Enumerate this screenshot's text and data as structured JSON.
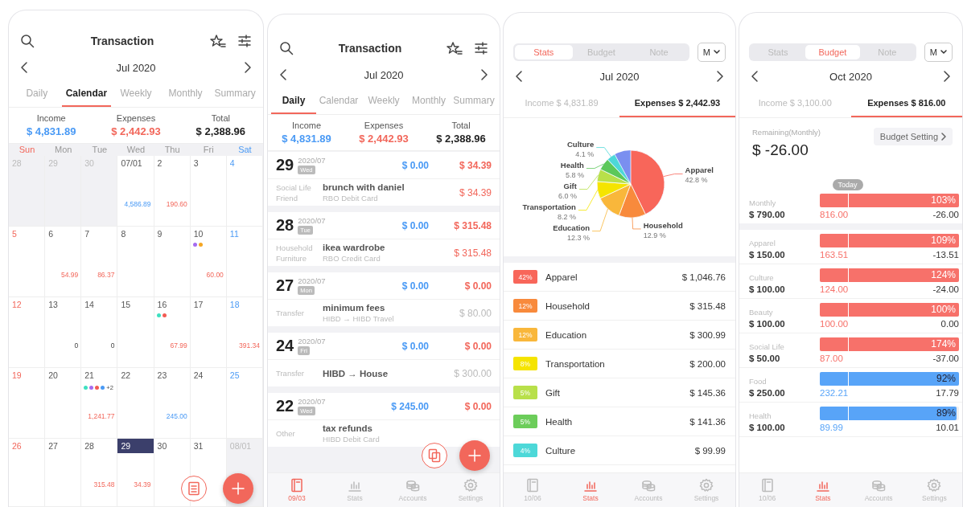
{
  "screens": [
    {
      "kind": "calendar",
      "header": {
        "title": "Transaction"
      },
      "month": "Jul 2020",
      "tabs": [
        {
          "label": "Daily",
          "selected": false
        },
        {
          "label": "Calendar",
          "selected": true
        },
        {
          "label": "Weekly",
          "selected": false
        },
        {
          "label": "Monthly",
          "selected": false
        },
        {
          "label": "Summary",
          "selected": false
        }
      ],
      "summary": [
        {
          "label": "Income",
          "value": "$ 4,831.89",
          "kind": "income"
        },
        {
          "label": "Expenses",
          "value": "$ 2,442.93",
          "kind": "expense"
        },
        {
          "label": "Total",
          "value": "$ 2,388.96",
          "kind": "total"
        }
      ],
      "weekdays": [
        "Sun",
        "Mon",
        "Tue",
        "Wed",
        "Thu",
        "Fri",
        "Sat"
      ],
      "weeks": [
        {
          "days": [
            {
              "day": "28",
              "outside": true,
              "selected": false
            },
            {
              "day": "29",
              "outside": true,
              "selected": false
            },
            {
              "day": "30",
              "outside": true,
              "selected": false
            },
            {
              "day": "07/01",
              "outside": false,
              "selected": false,
              "amount": "4,586.89",
              "kind": "income"
            },
            {
              "day": "2",
              "outside": false,
              "selected": false,
              "amount": "190.60",
              "kind": "expense"
            },
            {
              "day": "3",
              "outside": false,
              "selected": false
            },
            {
              "day": "4",
              "outside": false,
              "selected": false
            }
          ]
        },
        {
          "days": [
            {
              "day": "5",
              "outside": false,
              "selected": false
            },
            {
              "day": "6",
              "outside": false,
              "selected": false,
              "amount": "54.99",
              "kind": "expense"
            },
            {
              "day": "7",
              "outside": false,
              "selected": false,
              "amount": "86.37",
              "kind": "expense"
            },
            {
              "day": "8",
              "outside": false,
              "selected": false
            },
            {
              "day": "9",
              "outside": false,
              "selected": false
            },
            {
              "day": "10",
              "outside": false,
              "selected": false,
              "dots": [
                {
                  "color": "#a66cf0"
                },
                {
                  "color": "#f5a623"
                }
              ],
              "amount": "60.00",
              "kind": "expense"
            },
            {
              "day": "11",
              "outside": false,
              "selected": false
            }
          ]
        },
        {
          "days": [
            {
              "day": "12",
              "outside": false,
              "selected": false
            },
            {
              "day": "13",
              "outside": false,
              "selected": false,
              "amount": "0",
              "kind": "zero"
            },
            {
              "day": "14",
              "outside": false,
              "selected": false,
              "amount": "0",
              "kind": "zero"
            },
            {
              "day": "15",
              "outside": false,
              "selected": false
            },
            {
              "day": "16",
              "outside": false,
              "selected": false,
              "dots": [
                {
                  "color": "#3ee0c0"
                },
                {
                  "color": "#f25c54"
                }
              ],
              "amount": "67.99",
              "kind": "expense"
            },
            {
              "day": "17",
              "outside": false,
              "selected": false
            },
            {
              "day": "18",
              "outside": false,
              "selected": false,
              "amount": "391.34",
              "kind": "expense"
            }
          ]
        },
        {
          "days": [
            {
              "day": "19",
              "outside": false,
              "selected": false
            },
            {
              "day": "20",
              "outside": false,
              "selected": false
            },
            {
              "day": "21",
              "outside": false,
              "selected": false,
              "dots": [
                {
                  "color": "#3ee0c0"
                },
                {
                  "color": "#a66cf0"
                },
                {
                  "color": "#f25c54"
                },
                {
                  "color": "#4a9af5"
                }
              ],
              "more": "+2",
              "amount": "1,241.77",
              "kind": "expense"
            },
            {
              "day": "22",
              "outside": false,
              "selected": false
            },
            {
              "day": "23",
              "outside": false,
              "selected": false,
              "amount": "245.00",
              "kind": "income"
            },
            {
              "day": "24",
              "outside": false,
              "selected": false
            },
            {
              "day": "25",
              "outside": false,
              "selected": false
            }
          ]
        },
        {
          "days": [
            {
              "day": "26",
              "outside": false,
              "selected": false
            },
            {
              "day": "27",
              "outside": false,
              "selected": false
            },
            {
              "day": "28",
              "outside": false,
              "selected": false,
              "amount": "315.48",
              "kind": "expense"
            },
            {
              "day": "29",
              "outside": false,
              "selected": true,
              "amount": "34.39",
              "kind": "expense"
            },
            {
              "day": "30",
              "outside": false,
              "selected": false
            },
            {
              "day": "31",
              "outside": false,
              "selected": false
            },
            {
              "day": "08/01",
              "outside": true,
              "selected": false
            }
          ]
        }
      ]
    },
    {
      "kind": "daily",
      "header": {
        "title": "Transaction"
      },
      "month": "Jul 2020",
      "tabs": [
        {
          "label": "Daily",
          "selected": true
        },
        {
          "label": "Calendar",
          "selected": false
        },
        {
          "label": "Weekly",
          "selected": false
        },
        {
          "label": "Monthly",
          "selected": false
        },
        {
          "label": "Summary",
          "selected": false
        }
      ],
      "summary": [
        {
          "label": "Income",
          "value": "$ 4,831.89",
          "kind": "income"
        },
        {
          "label": "Expenses",
          "value": "$ 2,442.93",
          "kind": "expense"
        },
        {
          "label": "Total",
          "value": "$ 2,388.96",
          "kind": "total"
        }
      ],
      "days": [
        {
          "day": "29",
          "month": "2020/07",
          "weekday": "Wed",
          "income": "$ 0.00",
          "expense": "$ 34.39",
          "entries": [
            {
              "category": "Social Life",
              "subcategory": "Friend",
              "title": "brunch with daniel",
              "account": "RBO Debit Card",
              "amount": "$ 34.39",
              "kind": "expense"
            }
          ]
        },
        {
          "day": "28",
          "month": "2020/07",
          "weekday": "Tue",
          "income": "$ 0.00",
          "expense": "$ 315.48",
          "entries": [
            {
              "category": "Household",
              "subcategory": "Furniture",
              "title": "ikea wardrobe",
              "account": "RBO Credit Card",
              "amount": "$ 315.48",
              "kind": "expense"
            }
          ]
        },
        {
          "day": "27",
          "month": "2020/07",
          "weekday": "Mon",
          "income": "$ 0.00",
          "expense": "$ 0.00",
          "entries": [
            {
              "category": "Transfer",
              "title": "minimum fees",
              "account": "HIBD → HIBD Travel",
              "amount": "$ 80.00",
              "kind": "transfer"
            }
          ]
        },
        {
          "day": "24",
          "month": "2020/07",
          "weekday": "Fri",
          "income": "$ 0.00",
          "expense": "$ 0.00",
          "entries": [
            {
              "category": "Transfer",
              "title": "HIBD → House",
              "amount": "$ 300.00",
              "kind": "transfer"
            }
          ]
        },
        {
          "day": "22",
          "month": "2020/07",
          "weekday": "Wed",
          "income": "$ 245.00",
          "expense": "$ 0.00",
          "entries": [
            {
              "category": "Other",
              "title": "tax refunds",
              "account": "HIBD Debit Card"
            }
          ]
        }
      ],
      "nav": [
        {
          "label": "09/03",
          "kind": "book",
          "selected": true
        },
        {
          "label": "Stats",
          "kind": "stats",
          "selected": false
        },
        {
          "label": "Accounts",
          "kind": "accounts",
          "selected": false
        },
        {
          "label": "Settings",
          "kind": "settings",
          "selected": false
        }
      ]
    },
    {
      "kind": "stats",
      "segments": [
        {
          "label": "Stats",
          "selected": true
        },
        {
          "label": "Budget",
          "selected": false
        },
        {
          "label": "Note",
          "selected": false
        }
      ],
      "period": "M",
      "month": "Jul 2020",
      "tabs": [
        {
          "label": "Income $ 4,831.89",
          "selected": false
        },
        {
          "label": "Expenses $ 2,442.93",
          "selected": true
        }
      ],
      "chart_data": {
        "type": "pie",
        "categories": [
          "Apparel",
          "Household",
          "Education",
          "Transportation",
          "Gift",
          "Health",
          "Culture"
        ],
        "values": [
          42.8,
          12.9,
          12.3,
          8.2,
          6.0,
          5.8,
          4.1
        ],
        "colors": [
          "#f8665a",
          "#f88a3c",
          "#f9b73b",
          "#f5e400",
          "#b8e04a",
          "#5cc85a",
          "#4dd8d8"
        ],
        "value_labels": [
          "42.8 %",
          "12.9 %",
          "12.3 %",
          "8.2 %",
          "6.0 %",
          "5.8 %",
          "4.1 %"
        ]
      },
      "categories": [
        {
          "percent": "42%",
          "name": "Apparel",
          "amount": "$ 1,046.76",
          "color": "#f8665a"
        },
        {
          "percent": "12%",
          "name": "Household",
          "amount": "$ 315.48",
          "color": "#f88a3c"
        },
        {
          "percent": "12%",
          "name": "Education",
          "amount": "$ 300.99",
          "color": "#f9b73b"
        },
        {
          "percent": "8%",
          "name": "Transportation",
          "amount": "$ 200.00",
          "color": "#f5e400"
        },
        {
          "percent": "5%",
          "name": "Gift",
          "amount": "$ 145.36",
          "color": "#b8e04a"
        },
        {
          "percent": "5%",
          "name": "Health",
          "amount": "$ 141.36",
          "color": "#6ccd5a"
        },
        {
          "percent": "4%",
          "name": "Culture",
          "amount": "$ 99.99",
          "color": "#4dd8d8"
        }
      ],
      "nav": [
        {
          "label": "10/06",
          "kind": "book",
          "selected": false
        },
        {
          "label": "Stats",
          "kind": "stats",
          "selected": true
        },
        {
          "label": "Accounts",
          "kind": "accounts",
          "selected": false
        },
        {
          "label": "Settings",
          "kind": "settings",
          "selected": false
        }
      ]
    },
    {
      "kind": "budget",
      "segments": [
        {
          "label": "Stats",
          "selected": false
        },
        {
          "label": "Budget",
          "selected": true
        },
        {
          "label": "Note",
          "selected": false
        }
      ],
      "period": "M",
      "month": "Oct 2020",
      "tabs": [
        {
          "label": "Income $ 3,100.00",
          "selected": false
        },
        {
          "label": "Expenses $ 816.00",
          "selected": true
        }
      ],
      "remaining": {
        "label": "Remaining(Monthly)",
        "value": "$ -26.00"
      },
      "setting_button": "Budget Setting",
      "today": {
        "label": "Today",
        "level": 0.2
      },
      "monthly": {
        "name": "Monthly",
        "budget": "$ 790.00",
        "percent": "103%",
        "spent": "816.00",
        "remaining": "-26.00",
        "level": 1,
        "over": true
      },
      "rows": [
        {
          "name": "Apparel",
          "budget": "$ 150.00",
          "percent": "109%",
          "spent": "163.51",
          "remaining": "-13.51",
          "level": 1,
          "over": true
        },
        {
          "name": "Culture",
          "budget": "$ 100.00",
          "percent": "124%",
          "spent": "124.00",
          "remaining": "-24.00",
          "level": 1,
          "over": true
        },
        {
          "name": "Beauty",
          "budget": "$ 100.00",
          "percent": "100%",
          "spent": "100.00",
          "remaining": "0.00",
          "level": 1,
          "over": true
        },
        {
          "name": "Social Life",
          "budget": "$ 50.00",
          "percent": "174%",
          "spent": "87.00",
          "remaining": "-37.00",
          "level": 1,
          "over": true
        },
        {
          "name": "Food",
          "budget": "$ 250.00",
          "percent": "92%",
          "spent": "232.21",
          "remaining": "17.79",
          "level": 1,
          "over": false
        },
        {
          "name": "Health",
          "budget": "$ 100.00",
          "percent": "89%",
          "spent": "89.99",
          "remaining": "10.01",
          "level": 0.98,
          "over": false
        }
      ],
      "nav": [
        {
          "label": "10/06",
          "kind": "book",
          "selected": false
        },
        {
          "label": "Stats",
          "kind": "stats",
          "selected": true
        },
        {
          "label": "Accounts",
          "kind": "accounts",
          "selected": false
        },
        {
          "label": "Settings",
          "kind": "settings",
          "selected": false
        }
      ]
    }
  ]
}
